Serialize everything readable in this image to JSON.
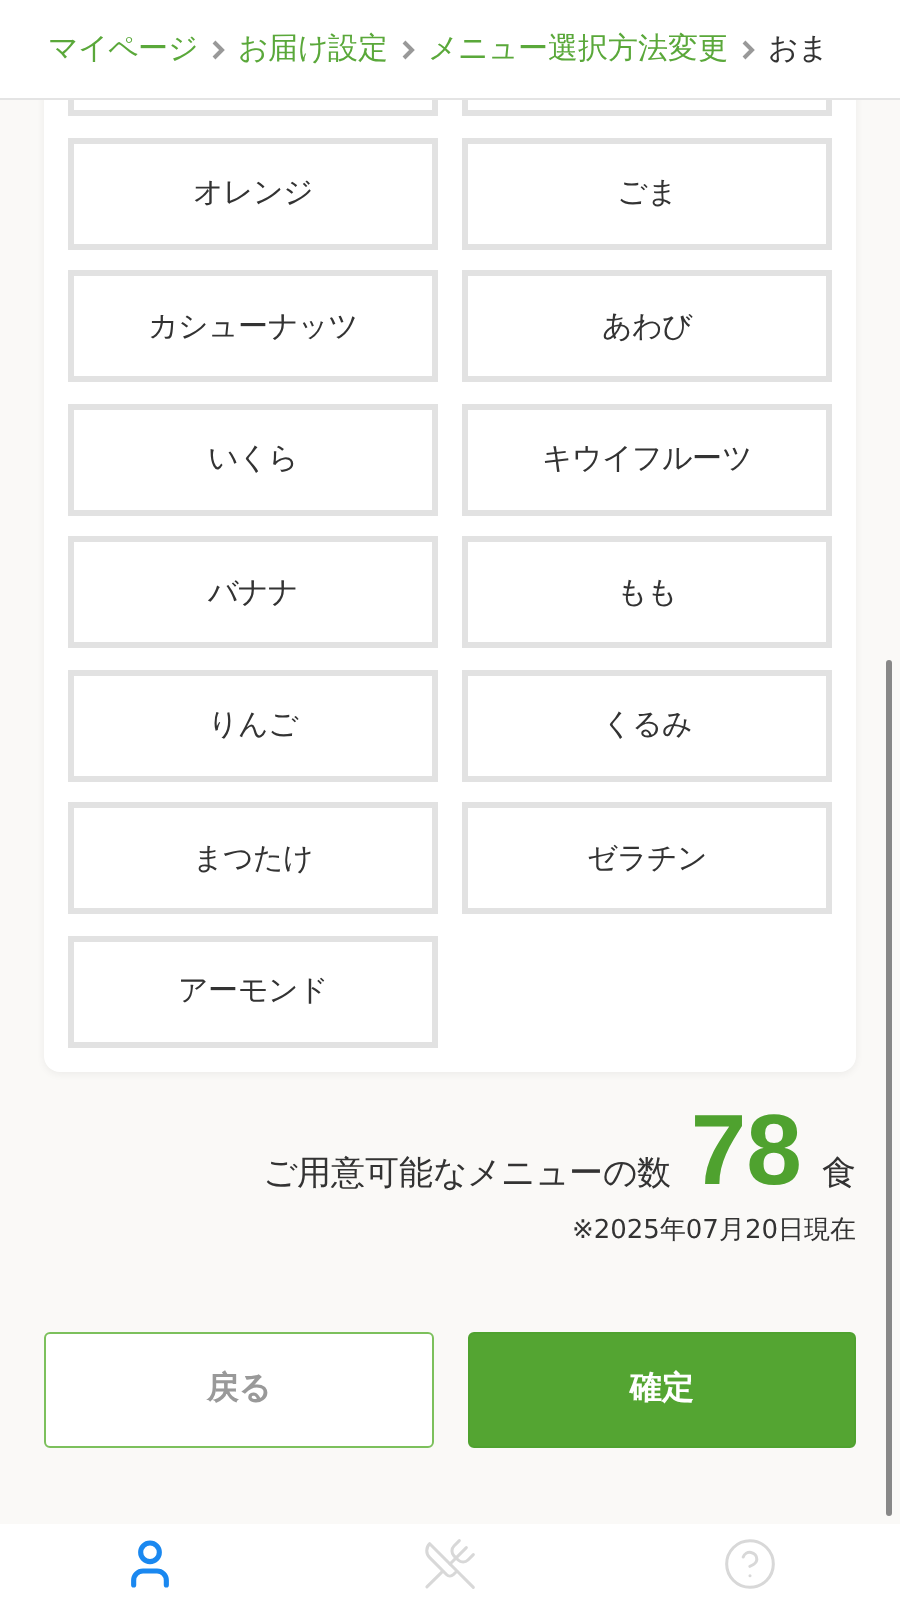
{
  "breadcrumb": [
    {
      "label": "マイページ",
      "link": true
    },
    {
      "label": "お届け設定",
      "link": true
    },
    {
      "label": "メニュー選択方法変更",
      "link": true
    },
    {
      "label": "おま",
      "link": false
    }
  ],
  "options": [
    {
      "label": "オレンジ"
    },
    {
      "label": "ごま"
    },
    {
      "label": "カシューナッツ"
    },
    {
      "label": "あわび"
    },
    {
      "label": "いくら"
    },
    {
      "label": "キウイフルーツ"
    },
    {
      "label": "バナナ"
    },
    {
      "label": "もも"
    },
    {
      "label": "りんご"
    },
    {
      "label": "くるみ"
    },
    {
      "label": "まつたけ"
    },
    {
      "label": "ゼラチン"
    },
    {
      "label": "アーモンド"
    }
  ],
  "count": {
    "label": "ご用意可能なメニューの数",
    "value": "78",
    "unit": "食",
    "note": "※2025年07月20日現在"
  },
  "buttons": [
    {
      "label": "戻る",
      "kind": "secondary"
    },
    {
      "label": "確定",
      "kind": "primary"
    }
  ],
  "tabs": [
    {
      "kind": "user",
      "selected": true
    },
    {
      "kind": "menu",
      "selected": false
    },
    {
      "kind": "help",
      "selected": false
    }
  ]
}
